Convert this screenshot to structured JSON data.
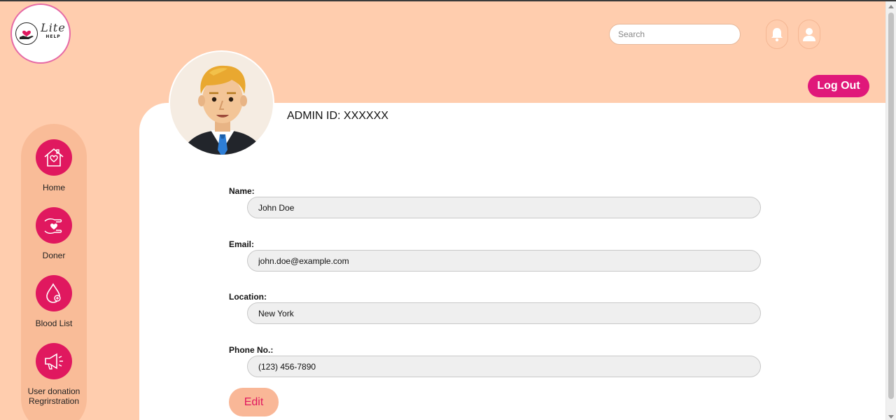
{
  "brand": {
    "logo_script": "Lite",
    "logo_subtext": "HELP",
    "primary_color": "#E0185F",
    "accent_color": "#E0187A",
    "background_color": "#FFCDAE"
  },
  "header": {
    "search_placeholder": "Search",
    "bell_icon": "bell-icon",
    "user_icon": "user-icon",
    "logout_label": "Log Out"
  },
  "sidebar": {
    "items": [
      {
        "label": "Home",
        "icon": "home-heart-icon"
      },
      {
        "label": "Doner",
        "icon": "hand-heart-icon"
      },
      {
        "label": "Blood List",
        "icon": "blood-drop-icon"
      },
      {
        "label_line1": "User donation",
        "label_line2": "Regrirstration",
        "icon": "megaphone-icon"
      }
    ]
  },
  "profile": {
    "admin_id": "ADMIN ID: XXXXXX",
    "fields": {
      "name": {
        "label": "Name:",
        "value": "John Doe"
      },
      "email": {
        "label": "Email:",
        "value": "john.doe@example.com"
      },
      "location": {
        "label": "Location:",
        "value": "New York"
      },
      "phone": {
        "label": "Phone No.:",
        "value": "(123) 456-7890"
      }
    },
    "edit_label": "Edit"
  }
}
